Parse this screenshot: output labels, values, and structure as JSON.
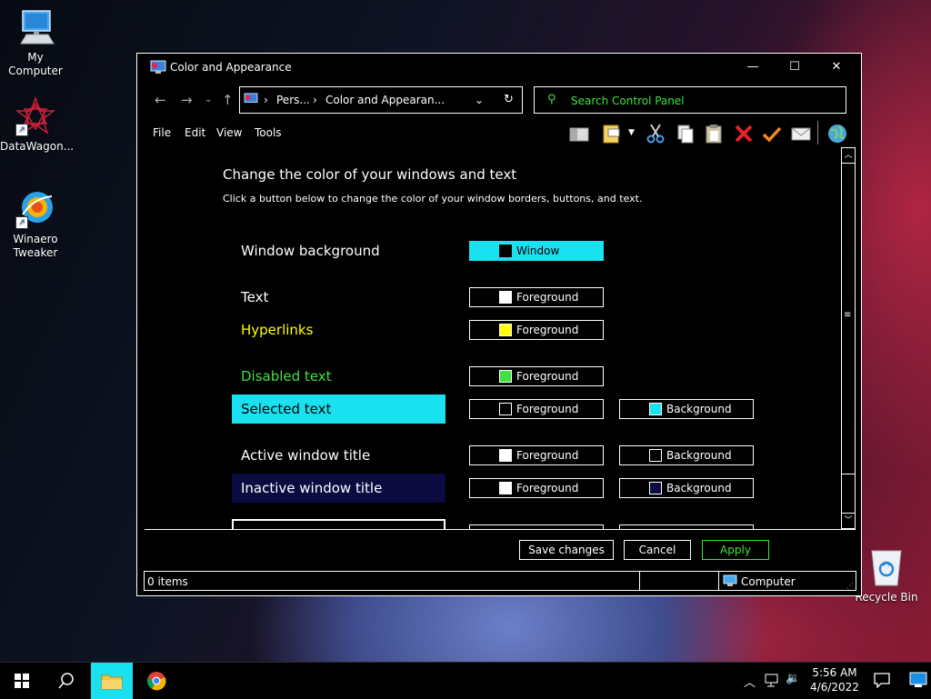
{
  "desktop": {
    "icons": [
      {
        "label": "My Computer"
      },
      {
        "label": "DataWagon..."
      },
      {
        "label": "Winaero Tweaker"
      },
      {
        "label": "Recycle Bin"
      }
    ]
  },
  "window": {
    "title": "Color and Appearance",
    "controls": {
      "minimize": "—",
      "maximize": "☐",
      "close": "✕"
    },
    "address": {
      "crumb1": "Pers...",
      "crumb2": "Color and Appearan...",
      "separator": "›"
    },
    "search": {
      "placeholder": "Search Control Panel"
    },
    "menu": [
      "File",
      "Edit",
      "View",
      "Tools"
    ],
    "content": {
      "heading": "Change the color of your windows and text",
      "subheading": "Click a button below to change the color of your window borders, buttons, and text.",
      "rows": [
        {
          "label": "Window background",
          "btn1": {
            "text": "Window",
            "swatch": "#000000"
          }
        },
        {
          "label": "Text",
          "btn1": {
            "text": "Foreground",
            "swatch": "#ffffff"
          }
        },
        {
          "label": "Hyperlinks",
          "btn1": {
            "text": "Foreground",
            "swatch": "#ffff00"
          }
        },
        {
          "label": "Disabled text",
          "btn1": {
            "text": "Foreground",
            "swatch": "#3fe23f"
          }
        },
        {
          "label": "Selected text",
          "btn1": {
            "text": "Foreground",
            "swatch": "#000000"
          },
          "btn2": {
            "text": "Background",
            "swatch": "#1ae1f0"
          }
        },
        {
          "label": "Active window title",
          "btn1": {
            "text": "Foreground",
            "swatch": "#ffffff"
          },
          "btn2": {
            "text": "Background",
            "swatch": "#000000"
          }
        },
        {
          "label": "Inactive window title",
          "btn1": {
            "text": "Foreground",
            "swatch": "#ffffff"
          },
          "btn2": {
            "text": "Background",
            "swatch": "#0b0b40"
          }
        }
      ]
    },
    "buttons": {
      "save": "Save changes",
      "cancel": "Cancel",
      "apply": "Apply"
    },
    "status": {
      "items": "0 items",
      "location": "Computer"
    }
  },
  "taskbar": {
    "time": "5:56 AM",
    "date": "4/6/2022",
    "active_app": "File Explorer"
  },
  "colors": {
    "accent_cyan": "#1ae1f0",
    "hyperlink": "#ffff00",
    "disabled": "#3fe23f",
    "inactive_title_bg": "#0b0b40"
  }
}
